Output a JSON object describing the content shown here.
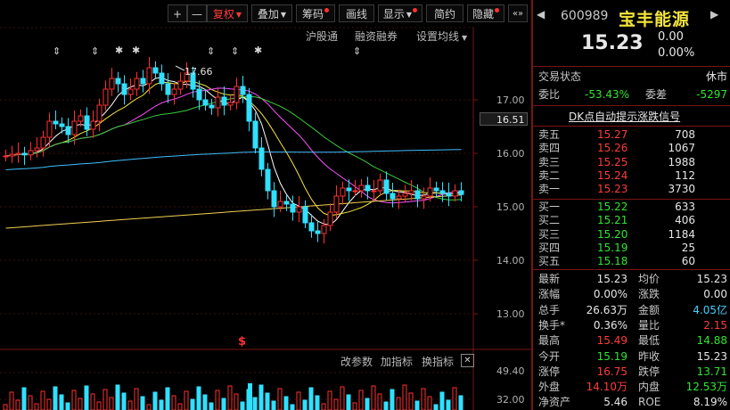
{
  "toolbar": {
    "plus": "+",
    "minus": "—",
    "fuquan": "复权",
    "diejia": "叠加",
    "chouma": "筹码",
    "huaxian": "画线",
    "xianshi": "显示",
    "jianyue": "简约",
    "yincang": "隐藏",
    "collapse": "«»"
  },
  "chart_links": {
    "hugutong": "沪股通",
    "rongzi": "融资融券",
    "set_ma": "设置均线"
  },
  "chart_annotations": {
    "high_marker": "17.66",
    "signal": "$"
  },
  "y_axis": {
    "ticks": [
      "17.00",
      "16.00",
      "15.00",
      "14.00",
      "13.00"
    ],
    "current_label": "16.51"
  },
  "indicator_bar": {
    "gai_canshu": "改参数",
    "jia_zhibiao": "加指标",
    "huan_zhibiao": "换指标",
    "close": "✕"
  },
  "volume_axis": {
    "ticks": [
      "49.40",
      "32.00"
    ]
  },
  "chart_data": {
    "type": "candlestick",
    "title": "",
    "ylim": [
      12.6,
      17.9
    ],
    "ma_colors": [
      "#ffffff",
      "#f5e53c",
      "#ff50ff",
      "#3ccc3c",
      "#3fbfff",
      "#f0d050"
    ]
  },
  "quote": {
    "code": "600989",
    "name": "宝丰能源",
    "price": "15.23",
    "change": "0.00",
    "change_pct": "0.00%",
    "trade_state_label": "交易状态",
    "trade_state_value": "休市",
    "weibi_label": "委比",
    "weibi_value": "-53.43%",
    "weicha_label": "委差",
    "weicha_value": "-5297",
    "dk_signal": "DK点自动提示涨跌信号"
  },
  "asks": [
    {
      "label": "卖五",
      "price": "15.27",
      "vol": "708"
    },
    {
      "label": "卖四",
      "price": "15.26",
      "vol": "1067"
    },
    {
      "label": "卖三",
      "price": "15.25",
      "vol": "1988"
    },
    {
      "label": "卖二",
      "price": "15.24",
      "vol": "112"
    },
    {
      "label": "卖一",
      "price": "15.23",
      "vol": "3730"
    }
  ],
  "bids": [
    {
      "label": "买一",
      "price": "15.22",
      "vol": "633"
    },
    {
      "label": "买二",
      "price": "15.21",
      "vol": "406"
    },
    {
      "label": "买三",
      "price": "15.20",
      "vol": "1184"
    },
    {
      "label": "买四",
      "price": "15.19",
      "vol": "25"
    },
    {
      "label": "买五",
      "price": "15.18",
      "vol": "60"
    }
  ],
  "stats": [
    {
      "l1": "最新",
      "v1": "15.23",
      "c1": "white",
      "l2": "均价",
      "v2": "15.23",
      "c2": "white"
    },
    {
      "l1": "涨幅",
      "v1": "0.00%",
      "c1": "white",
      "l2": "涨跌",
      "v2": "0.00",
      "c2": "white"
    },
    {
      "l1": "总手",
      "v1": "26.63万",
      "c1": "white",
      "l2": "金额",
      "v2": "4.05亿",
      "c2": "cyan"
    },
    {
      "l1": "换手*",
      "v1": "0.36%",
      "c1": "white",
      "l2": "量比",
      "v2": "2.15",
      "c2": "red"
    },
    {
      "l1": "最高",
      "v1": "15.49",
      "c1": "red",
      "l2": "最低",
      "v2": "14.88",
      "c2": "green"
    },
    {
      "l1": "今开",
      "v1": "15.19",
      "c1": "green",
      "l2": "昨收",
      "v2": "15.23",
      "c2": "white"
    },
    {
      "l1": "涨停",
      "v1": "16.75",
      "c1": "red",
      "l2": "跌停",
      "v2": "13.71",
      "c2": "green"
    },
    {
      "l1": "外盘",
      "v1": "14.10万",
      "c1": "red",
      "l2": "内盘",
      "v2": "12.53万",
      "c2": "green"
    },
    {
      "l1": "净资产",
      "v1": "5.46",
      "c1": "white",
      "l2": "ROE",
      "v2": "8.19%",
      "c2": "white"
    }
  ]
}
